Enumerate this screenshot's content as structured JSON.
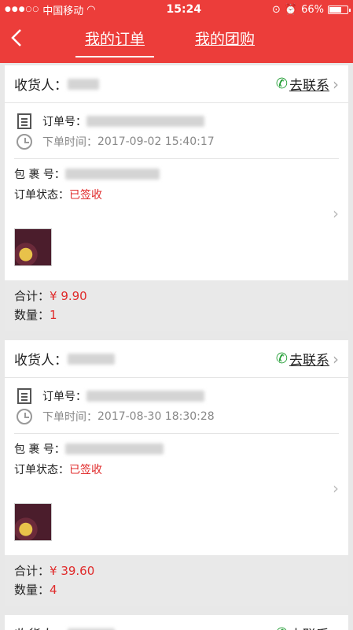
{
  "status_bar": {
    "carrier": "中国移动",
    "time": "15:24",
    "battery": "66%",
    "battery_level": 0.66
  },
  "nav": {
    "back_icon": "chevron-left-icon",
    "tabs": [
      {
        "label": "我的订单",
        "active": true
      },
      {
        "label": "我的团购",
        "active": false
      }
    ]
  },
  "orders": [
    {
      "receiver_label": "收货人：",
      "contact_label": "去联系",
      "order_no_label": "订单号：",
      "order_time_label": "下单时间：",
      "order_time": "2017-09-02 15:40:17",
      "package_label": "包 裹 号：",
      "state_label": "订单状态：",
      "state": "已签收",
      "total_label": "合计：",
      "total": "¥ 9.90",
      "qty_label": "数量：",
      "qty": "1"
    },
    {
      "receiver_label": "收货人：",
      "contact_label": "去联系",
      "order_no_label": "订单号：",
      "order_time_label": "下单时间：",
      "order_time": "2017-08-30 18:30:28",
      "package_label": "包 裹 号：",
      "state_label": "订单状态：",
      "state": "已签收",
      "total_label": "合计：",
      "total": "¥ 39.60",
      "qty_label": "数量：",
      "qty": "4"
    },
    {
      "receiver_label": "收货人：",
      "contact_label": "去联系"
    }
  ]
}
